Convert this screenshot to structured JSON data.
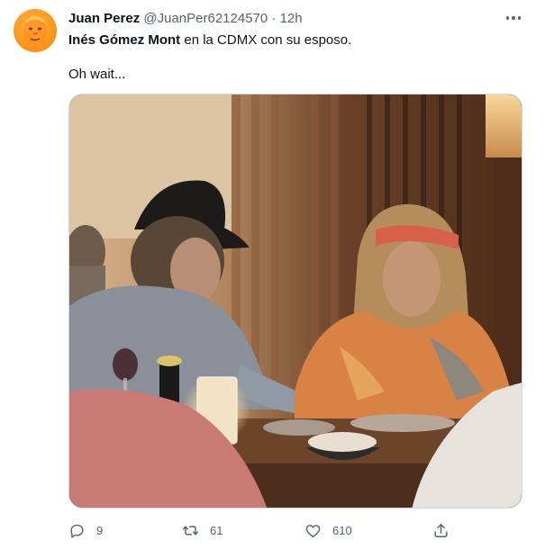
{
  "author": {
    "display_name": "Juan Perez",
    "handle": "@JuanPer62124570",
    "separator": "·",
    "time": "12h",
    "avatar_icon": "orange-face-avatar"
  },
  "tweet": {
    "mention": "Inés Gómez Mont",
    "text_rest": " en la CDMX con su esposo.",
    "line2": "Oh wait..."
  },
  "media": {
    "description_icon": "photo-couple-restaurant"
  },
  "actions": {
    "reply_count": "9",
    "retweet_count": "61",
    "like_count": "610"
  },
  "colors": {
    "text": "#0f1419",
    "secondary": "#536471",
    "border": "#cfd9de"
  }
}
